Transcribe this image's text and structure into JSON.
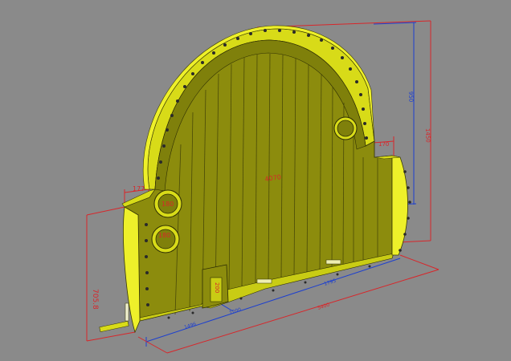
{
  "viewport": {
    "background": "#8a8a8a"
  },
  "colors": {
    "face": "#8c8c0d",
    "face_dark": "#6f700a",
    "rim": "#d8db18",
    "rim_bright": "#eef02a",
    "plank_line": "#4a4a08",
    "dim_red": "#d8262a",
    "dim_blue": "#1c3fd0"
  },
  "dimensions": {
    "arch_height": "950",
    "total_height": "1450",
    "right_step": "170",
    "left_step": "177",
    "opening_width": "4070",
    "left_height": "705.8",
    "port_upper": "180",
    "port_lower": "180",
    "hatch_height": "200",
    "base_span_a": "1496",
    "base_span_b": "1795",
    "base_small": "1200",
    "base_total": "5400"
  }
}
